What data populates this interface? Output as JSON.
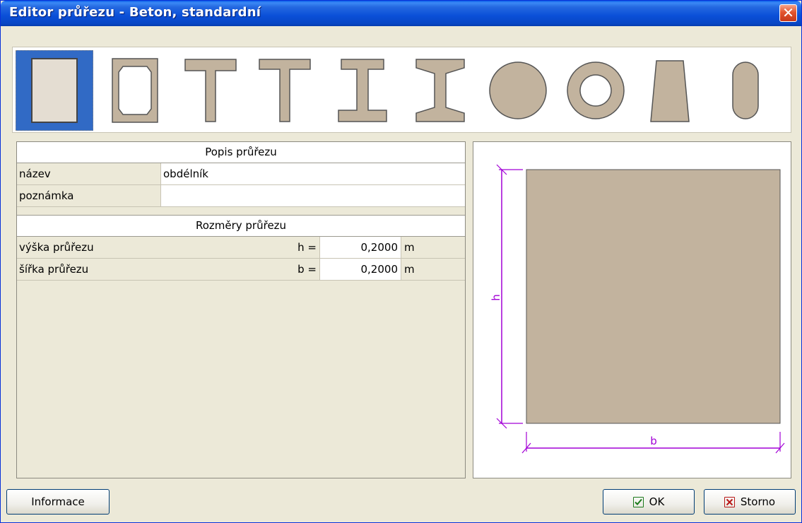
{
  "window": {
    "title": "Editor průřezu - Beton, standardní",
    "close_icon": "close-icon"
  },
  "shapes": [
    {
      "name": "shape-rectangle-icon",
      "selected": true
    },
    {
      "name": "shape-octagon-hollow-icon",
      "selected": false
    },
    {
      "name": "shape-t-section-icon",
      "selected": false
    },
    {
      "name": "shape-t-section-tapered-icon",
      "selected": false
    },
    {
      "name": "shape-i-section-icon",
      "selected": false
    },
    {
      "name": "shape-i-section-tapered-icon",
      "selected": false
    },
    {
      "name": "shape-circle-icon",
      "selected": false
    },
    {
      "name": "shape-ring-icon",
      "selected": false
    },
    {
      "name": "shape-trapezoid-icon",
      "selected": false
    },
    {
      "name": "shape-oval-icon",
      "selected": false
    }
  ],
  "description": {
    "header": "Popis průřezu",
    "name_label": "název",
    "name_value": "obdélník",
    "note_label": "poznámka",
    "note_value": ""
  },
  "dimensions": {
    "header": "Rozměry průřezu",
    "rows": [
      {
        "label": "výška průřezu",
        "symbol": "h =",
        "value": "0,2000",
        "unit": "m"
      },
      {
        "label": "šířka průřezu",
        "symbol": "b =",
        "value": "0,2000",
        "unit": "m"
      }
    ]
  },
  "preview": {
    "h_label": "h",
    "b_label": "b",
    "fill_color": "#C2B39E",
    "dim_color": "#A200D6"
  },
  "buttons": {
    "info": "Informace",
    "ok": "OK",
    "cancel": "Storno"
  }
}
